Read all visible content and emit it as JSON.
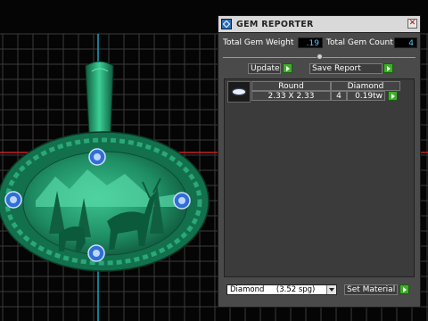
{
  "panel": {
    "title": "GEM REPORTER",
    "close_symbol": "✕",
    "total_weight_label": "Total Gem Weight",
    "total_weight_value": ".19",
    "total_count_label": "Total Gem Count",
    "total_count_value": "4",
    "slider_level": 0.5,
    "update_label": "Update",
    "save_report_label": "Save Report",
    "table": {
      "header_shape": "Round",
      "header_material": "Diamond",
      "rows": [
        {
          "size": "2.33 X 2.33",
          "count": "4",
          "weight": "0.19tw"
        }
      ]
    },
    "material_select_value": "Diamond     (3.52 spg)",
    "set_material_label": "Set Material"
  },
  "colors": {
    "accent_go": "#3fae2a",
    "value_text": "#55c8ff",
    "model_green": "#1e8c63",
    "gem_blue": "#8fb4ff",
    "axis_cyan": "#16a7c4",
    "axis_red": "#c81e1e"
  },
  "icons": {
    "title": "gem-reporter-icon",
    "close": "close-icon",
    "go": "green-arrow-icon",
    "gem": "round-gem-icon",
    "dropdown": "chevron-down-icon"
  }
}
